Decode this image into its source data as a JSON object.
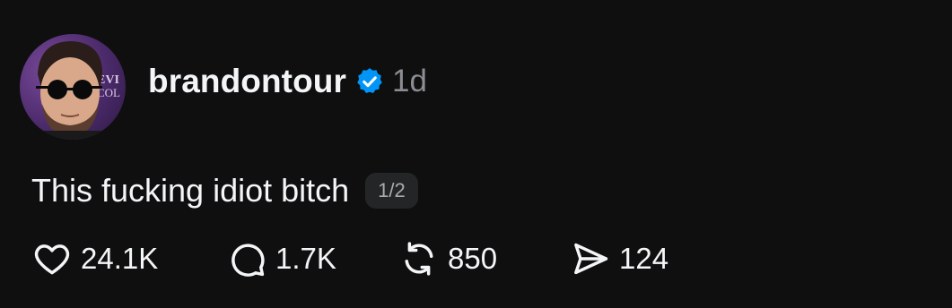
{
  "post": {
    "username": "brandontour",
    "timestamp": "1d",
    "text": "This fucking idiot bitch",
    "thread_position": "1/2",
    "avatar_background_text": "EVI COL",
    "actions": {
      "likes": "24.1K",
      "replies": "1.7K",
      "reposts": "850",
      "shares": "124"
    }
  },
  "colors": {
    "background": "#0f0f10",
    "text": "#f3f5f7",
    "muted": "#8a8d91",
    "verified": "#0095f6",
    "badge_bg": "#242526"
  },
  "icons": {
    "verified": "verified-badge-icon",
    "like": "heart-icon",
    "reply": "speech-bubble-icon",
    "repost": "repost-arrows-icon",
    "share": "send-arrow-icon"
  }
}
